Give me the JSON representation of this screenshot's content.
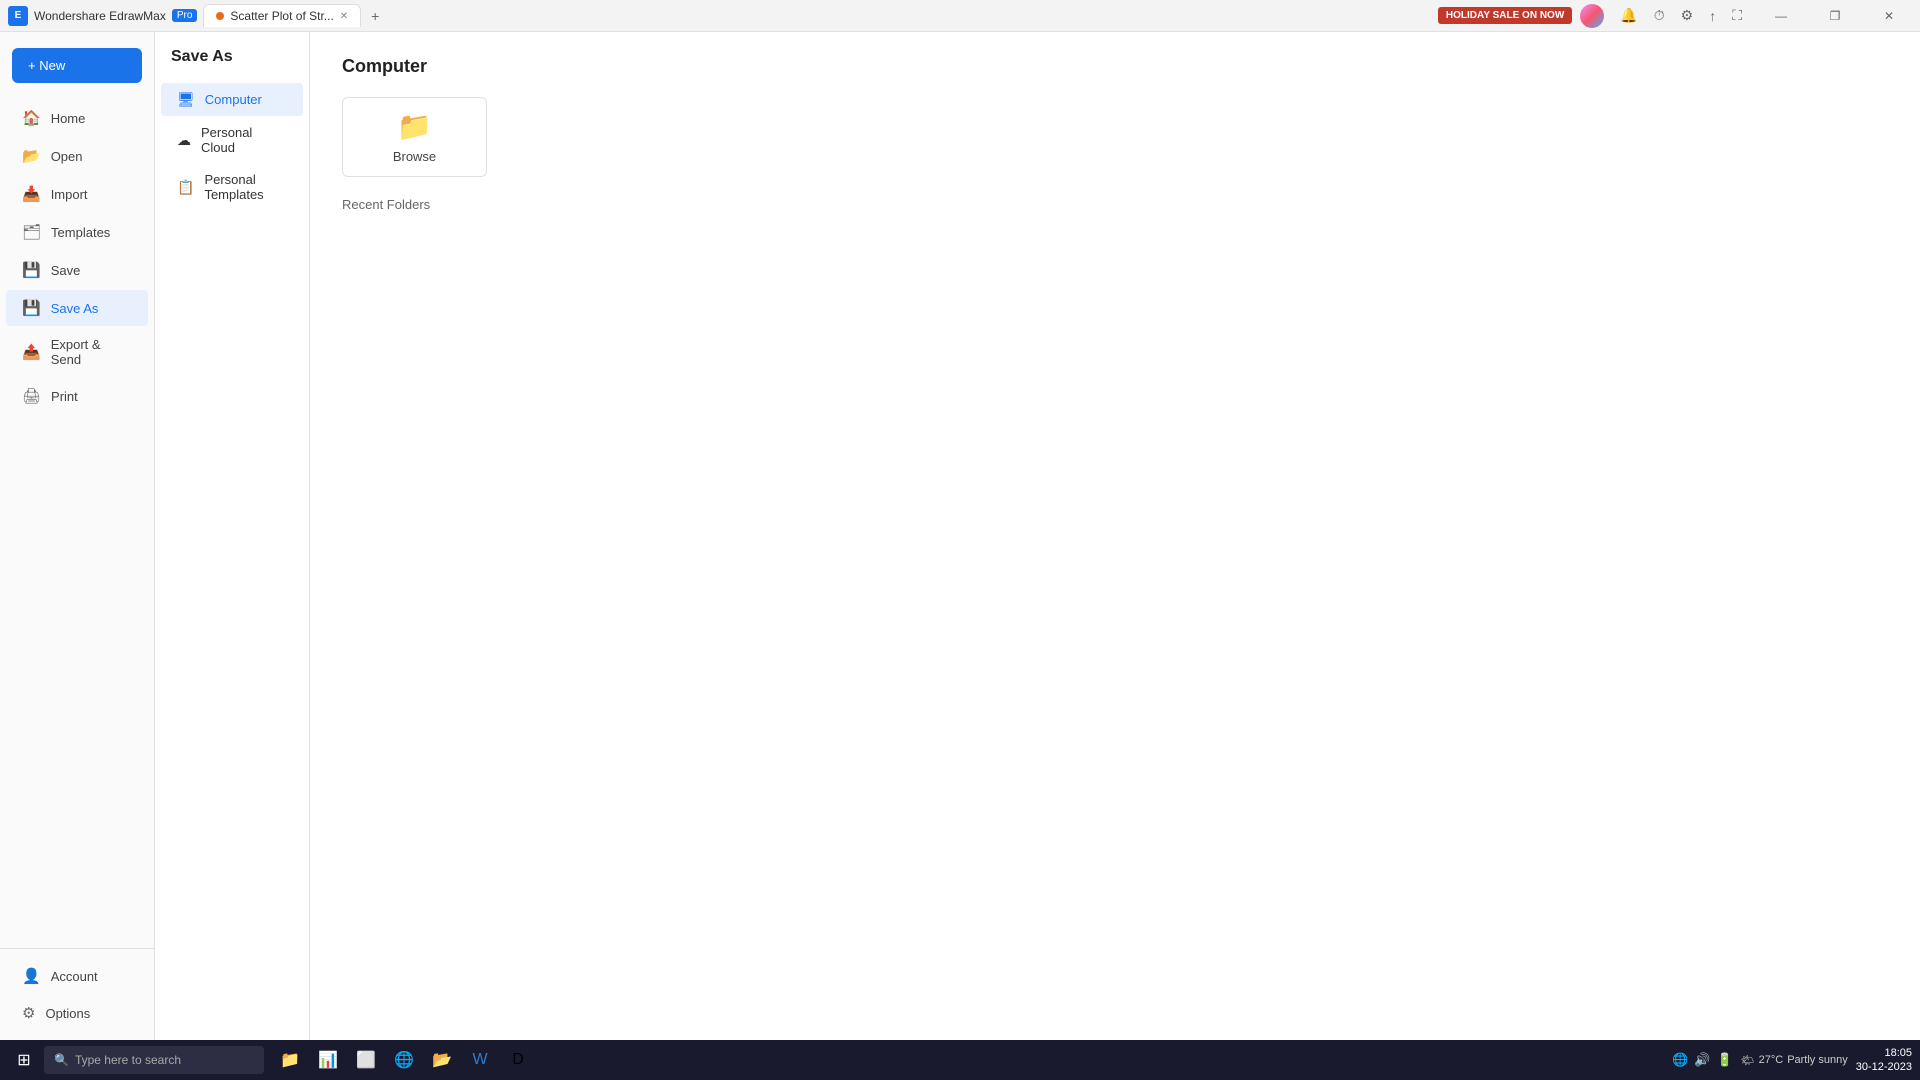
{
  "titlebar": {
    "app_name": "Wondershare EdrawMax",
    "badge": "Pro",
    "tab_title": "Scatter Plot of Str...",
    "holiday_label": "HOLIDAY SALE ON NOW",
    "minimize": "—",
    "restore": "❐",
    "close": "✕"
  },
  "sidebar": {
    "new_label": "+ New",
    "items": [
      {
        "id": "home",
        "label": "Home",
        "icon": "🏠"
      },
      {
        "id": "open",
        "label": "Open",
        "icon": "📂"
      },
      {
        "id": "import",
        "label": "Import",
        "icon": "📥"
      },
      {
        "id": "templates",
        "label": "Templates",
        "icon": "🗂"
      },
      {
        "id": "save",
        "label": "Save",
        "icon": "💾"
      },
      {
        "id": "save-as",
        "label": "Save As",
        "icon": "💾",
        "active": true
      },
      {
        "id": "export-send",
        "label": "Export & Send",
        "icon": "📤"
      },
      {
        "id": "print",
        "label": "Print",
        "icon": "🖨"
      }
    ],
    "bottom_items": [
      {
        "id": "account",
        "label": "Account",
        "icon": "👤"
      },
      {
        "id": "options",
        "label": "Options",
        "icon": "⚙"
      }
    ]
  },
  "middle_panel": {
    "title": "Save As",
    "items": [
      {
        "id": "computer",
        "label": "Computer",
        "icon": "🖥",
        "active": true
      },
      {
        "id": "personal-cloud",
        "label": "Personal Cloud",
        "icon": "☁"
      },
      {
        "id": "personal-templates",
        "label": "Personal Templates",
        "icon": "📋"
      }
    ]
  },
  "main_content": {
    "title": "Computer",
    "browse_label": "Browse",
    "recent_folders_label": "Recent Folders"
  },
  "taskbar": {
    "search_placeholder": "Type here to search",
    "weather_temp": "27°C",
    "weather_desc": "Partly sunny",
    "time": "18:05",
    "date": "30-12-2023"
  }
}
